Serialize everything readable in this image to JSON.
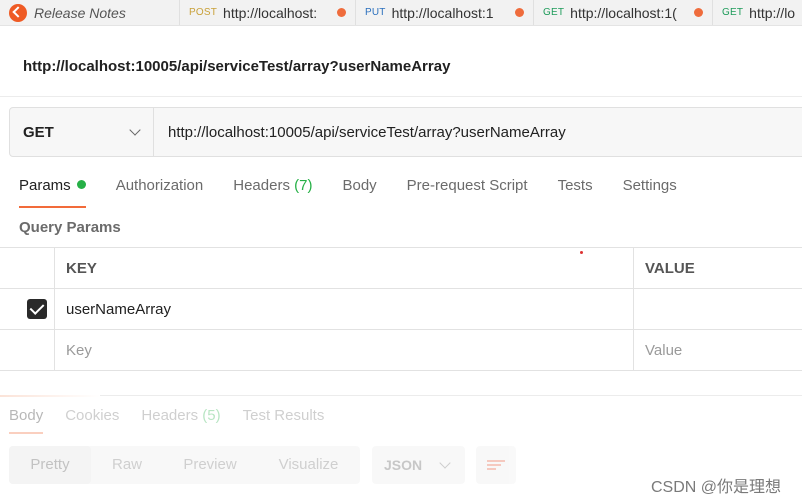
{
  "tabs": {
    "release": {
      "title": "Release Notes",
      "icon": "postman-logo-icon"
    },
    "requests": [
      {
        "method": "POST",
        "url": "http://localhost:"
      },
      {
        "method": "PUT",
        "url": "http://localhost:1"
      },
      {
        "method": "GET",
        "url": "http://localhost:1("
      },
      {
        "method": "GET",
        "url": "http://lo"
      }
    ]
  },
  "request": {
    "name": "http://localhost:10005/api/serviceTest/array?userNameArray",
    "method": "GET",
    "url": "http://localhost:10005/api/serviceTest/array?userNameArray"
  },
  "request_tabs": {
    "params": "Params",
    "authorization": "Authorization",
    "headers": "Headers",
    "headers_count": "(7)",
    "body": "Body",
    "prerequest": "Pre-request Script",
    "tests": "Tests",
    "settings": "Settings"
  },
  "query_params": {
    "title": "Query Params",
    "columns": {
      "key": "KEY",
      "value": "VALUE"
    },
    "rows": [
      {
        "checked": true,
        "key": "userNameArray",
        "value": ""
      }
    ],
    "placeholder": {
      "key": "Key",
      "value": "Value"
    }
  },
  "response": {
    "tabs": {
      "body": "Body",
      "cookies": "Cookies",
      "headers": "Headers",
      "headers_count": "(5)",
      "test_results": "Test Results"
    },
    "views": [
      "Pretty",
      "Raw",
      "Preview",
      "Visualize"
    ],
    "format": "JSON"
  },
  "watermark": "CSDN @你是理想",
  "colors": {
    "accent": "#f26b3a",
    "green": "#26b047",
    "post": "#c9a13a",
    "put": "#2a6fbd",
    "get": "#1e9b5a"
  }
}
